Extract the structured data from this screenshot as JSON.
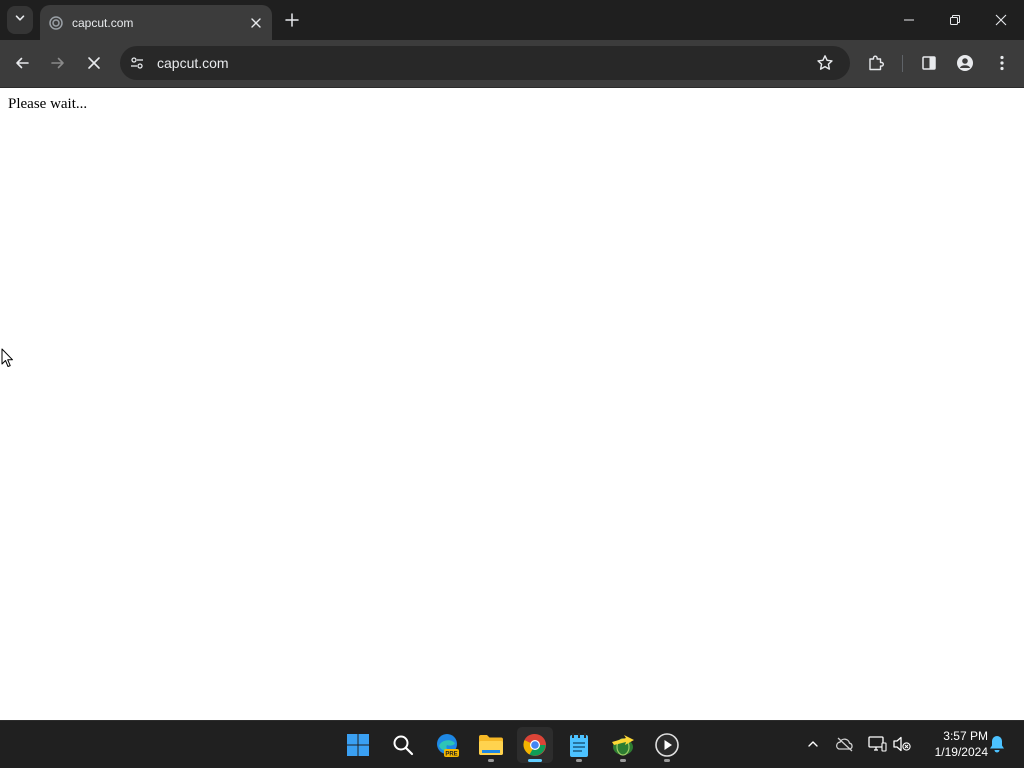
{
  "browser": {
    "tab": {
      "title": "capcut.com",
      "favicon": "loading-spinner-icon"
    },
    "toolbar": {
      "url": "capcut.com",
      "back_icon": "back-arrow-icon",
      "forward_icon": "forward-arrow-icon",
      "stop_icon": "stop-loading-icon",
      "site_info_icon": "tune-icon",
      "bookmark_icon": "star-icon",
      "extensions_icon": "puzzle-icon",
      "side_panel_icon": "side-panel-icon",
      "profile_icon": "profile-icon",
      "menu_icon": "kebab-menu-icon"
    },
    "window_controls": [
      "minimize",
      "restore",
      "close"
    ]
  },
  "page": {
    "text": "Please wait..."
  },
  "taskbar": {
    "apps": [
      {
        "name": "start",
        "icon": "windows-logo-icon",
        "running": false
      },
      {
        "name": "search",
        "icon": "search-icon",
        "running": false
      },
      {
        "name": "edge-pre",
        "icon": "edge-icon",
        "badge": "PRE",
        "running": false
      },
      {
        "name": "file-explorer",
        "icon": "folder-icon",
        "running": true
      },
      {
        "name": "chrome",
        "icon": "chrome-icon",
        "running": true,
        "active": true
      },
      {
        "name": "notepad",
        "icon": "notepad-icon",
        "running": true
      },
      {
        "name": "network-app",
        "icon": "globe-arrow-icon",
        "running": true
      },
      {
        "name": "media-player",
        "icon": "play-icon",
        "running": true
      }
    ],
    "tray": {
      "icons": [
        "chevron-up-icon",
        "onedrive-offline-icon",
        "network-icon",
        "volume-muted-icon",
        "notification-bell-icon"
      ],
      "time": "3:57 PM",
      "date": "1/19/2024"
    }
  },
  "colors": {
    "tabstrip": "#1f1f1f",
    "toolbar": "#3c3c3c",
    "omnibox": "#282828",
    "taskbar": "#202020",
    "accent": "#60cdff"
  }
}
